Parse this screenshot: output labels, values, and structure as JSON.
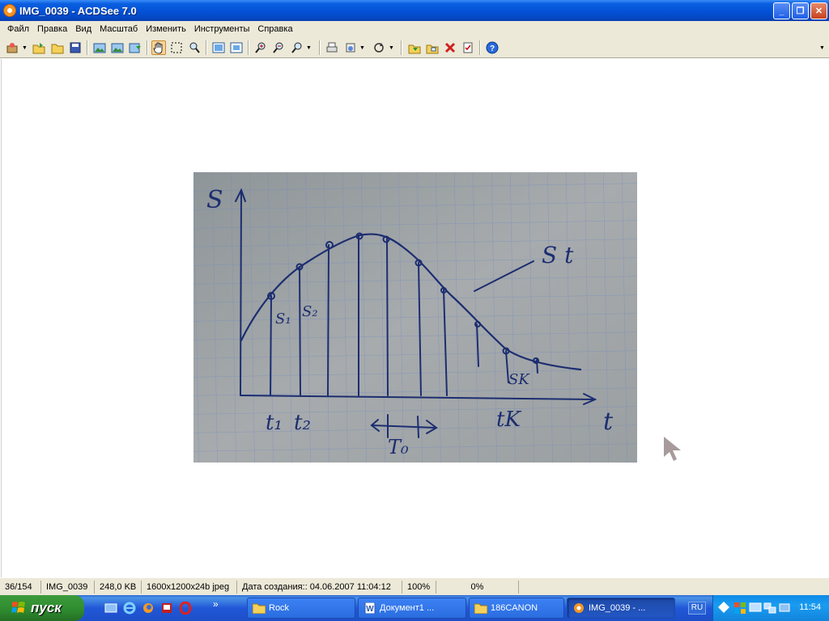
{
  "window": {
    "title": "IMG_0039 - ACDSee 7.0",
    "minimize": "_",
    "maximize": "❐",
    "close": "✕"
  },
  "menu": [
    "Файл",
    "Правка",
    "Вид",
    "Масштаб",
    "Изменить",
    "Инструменты",
    "Справка"
  ],
  "toolbar": {
    "buttons": [
      "acquire",
      "open",
      "folder",
      "save",
      "prev-image",
      "next-image",
      "export",
      "hand-tool",
      "select-tool",
      "zoom-tool",
      "fit-window",
      "actual-size",
      "zoom-in",
      "zoom-out",
      "zoom-options",
      "print",
      "send",
      "rotate",
      "move-to",
      "copy-to",
      "delete",
      "properties",
      "help"
    ]
  },
  "photo": {
    "labels": {
      "y_axis": "S",
      "x_axis": "t",
      "curve": "S t",
      "s1": "S₁",
      "s2": "S₂",
      "sk": "SK",
      "t1": "t₁",
      "t2": "t₂",
      "tk": "tK",
      "t0": "T₀"
    }
  },
  "status": {
    "index": "36/154",
    "filename": "IMG_0039",
    "filesize": "248,0 KB",
    "dimensions": "1600x1200x24b jpeg",
    "created": "Дата создания:: 04.06.2007 11:04:12",
    "zoom": "100%",
    "progress": "0%"
  },
  "taskbar": {
    "start_label": "пуск",
    "more": "»",
    "tasks": [
      {
        "label": "Rock",
        "icon": "folder-icon"
      },
      {
        "label": "Документ1 ...",
        "icon": "word-icon"
      },
      {
        "label": "186CANON",
        "icon": "folder-icon"
      },
      {
        "label": "IMG_0039 - ...",
        "icon": "acdsee-icon",
        "active": true
      }
    ],
    "lang": "RU",
    "clock": "11:54"
  },
  "colors": {
    "titlebar": "#0352d6",
    "chrome": "#ece9d8",
    "taskbar": "#2157d7",
    "start": "#2e8a2e",
    "ink": "#1c2d70"
  }
}
